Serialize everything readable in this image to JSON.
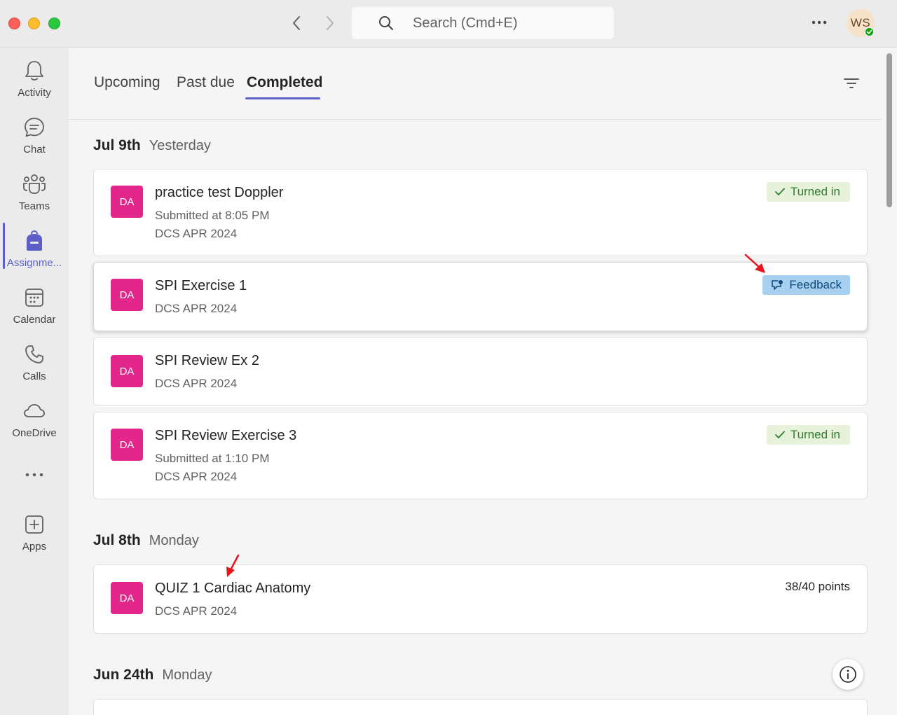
{
  "search": {
    "placeholder": "Search (Cmd+E)"
  },
  "user": {
    "initials": "WS"
  },
  "rail": [
    {
      "label": "Activity",
      "icon": "bell-icon"
    },
    {
      "label": "Chat",
      "icon": "chat-icon"
    },
    {
      "label": "Teams",
      "icon": "teams-icon"
    },
    {
      "label": "Assignme...",
      "icon": "backpack-icon",
      "active": true
    },
    {
      "label": "Calendar",
      "icon": "calendar-icon"
    },
    {
      "label": "Calls",
      "icon": "phone-icon"
    },
    {
      "label": "OneDrive",
      "icon": "cloud-icon"
    },
    {
      "label": "Apps",
      "icon": "plus-square-icon"
    }
  ],
  "tabs": [
    {
      "label": "Upcoming"
    },
    {
      "label": "Past due"
    },
    {
      "label": "Completed",
      "selected": true
    }
  ],
  "groups": [
    {
      "date": "Jul 9th",
      "day": "Yesterday",
      "items": [
        {
          "badge": "DA",
          "title": "practice test Doppler",
          "submitted": "Submitted at 8:05 PM",
          "class": "DCS APR 2024",
          "status": "Turned in"
        },
        {
          "badge": "DA",
          "title": "SPI Exercise 1",
          "class": "DCS APR 2024",
          "status": "Feedback"
        },
        {
          "badge": "DA",
          "title": "SPI Review Ex 2",
          "class": "DCS APR 2024"
        },
        {
          "badge": "DA",
          "title": "SPI Review Exercise 3",
          "submitted": "Submitted at 1:10 PM",
          "class": "DCS APR 2024",
          "status": "Turned in"
        }
      ]
    },
    {
      "date": "Jul 8th",
      "day": "Monday",
      "items": [
        {
          "badge": "DA",
          "title": "QUIZ 1 Cardiac Anatomy",
          "class": "DCS APR 2024",
          "points": "38/40 points"
        }
      ]
    },
    {
      "date": "Jun 24th",
      "day": "Monday",
      "items": []
    }
  ],
  "colors": {
    "accent": "#5b5fc7",
    "badge": "#e3268b",
    "turned_in_bg": "#e7f2da",
    "feedback_bg": "#a7d0f0",
    "annotation_arrow": "#e8141b"
  }
}
